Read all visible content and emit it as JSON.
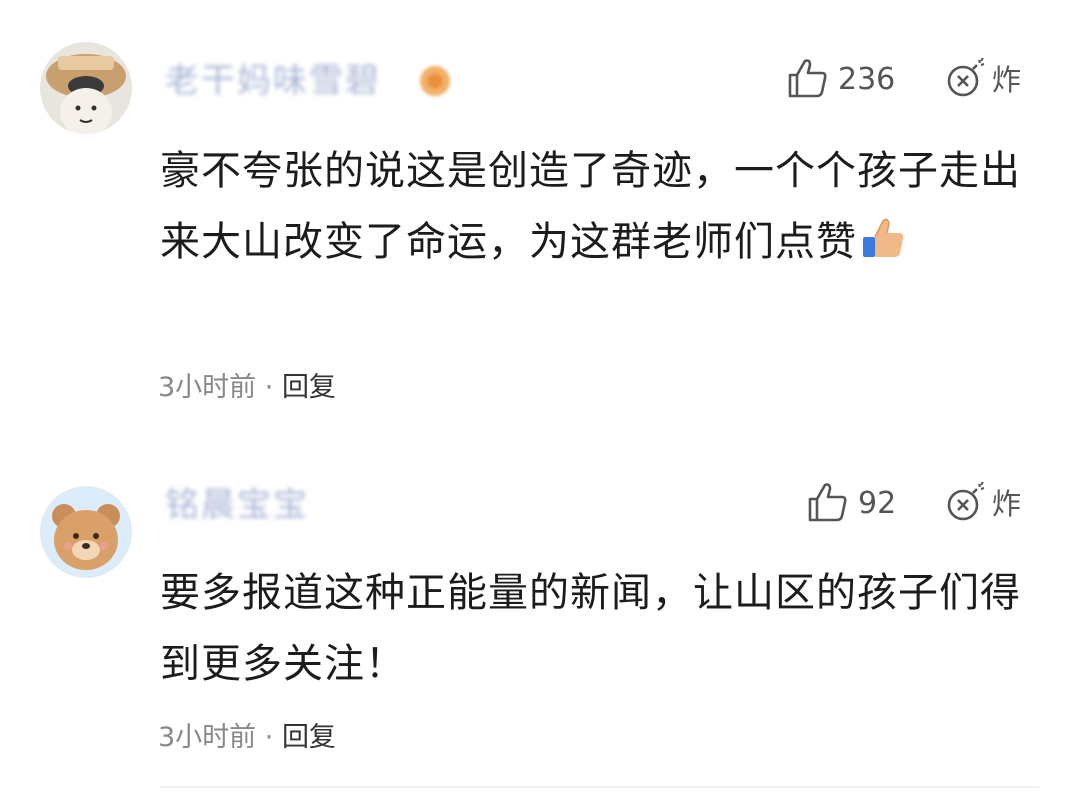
{
  "comments": [
    {
      "username": "老干妈味雪碧",
      "likes": "236",
      "bomb_label": "炸",
      "text": "豪不夸张的说这是创造了奇迹，一个个孩子走出来大山改变了命运，为这群老师们点赞",
      "emoji": "thumbs-up-emoji",
      "time": "3小时前",
      "separator": " · ",
      "reply": "回复"
    },
    {
      "username": "铭晨宝宝",
      "likes": "92",
      "bomb_label": "炸",
      "text": "要多报道这种正能量的新闻，让山区的孩子们得到更多关注！",
      "time": "3小时前",
      "separator": " · ",
      "reply": "回复"
    }
  ],
  "icons": {
    "like": "thumbs-up-icon",
    "bomb": "bomb-icon"
  },
  "colors": {
    "username": "#a9b7d6",
    "badge": "#f0a35c",
    "meta": "#888888",
    "text": "#1c1c1c"
  }
}
